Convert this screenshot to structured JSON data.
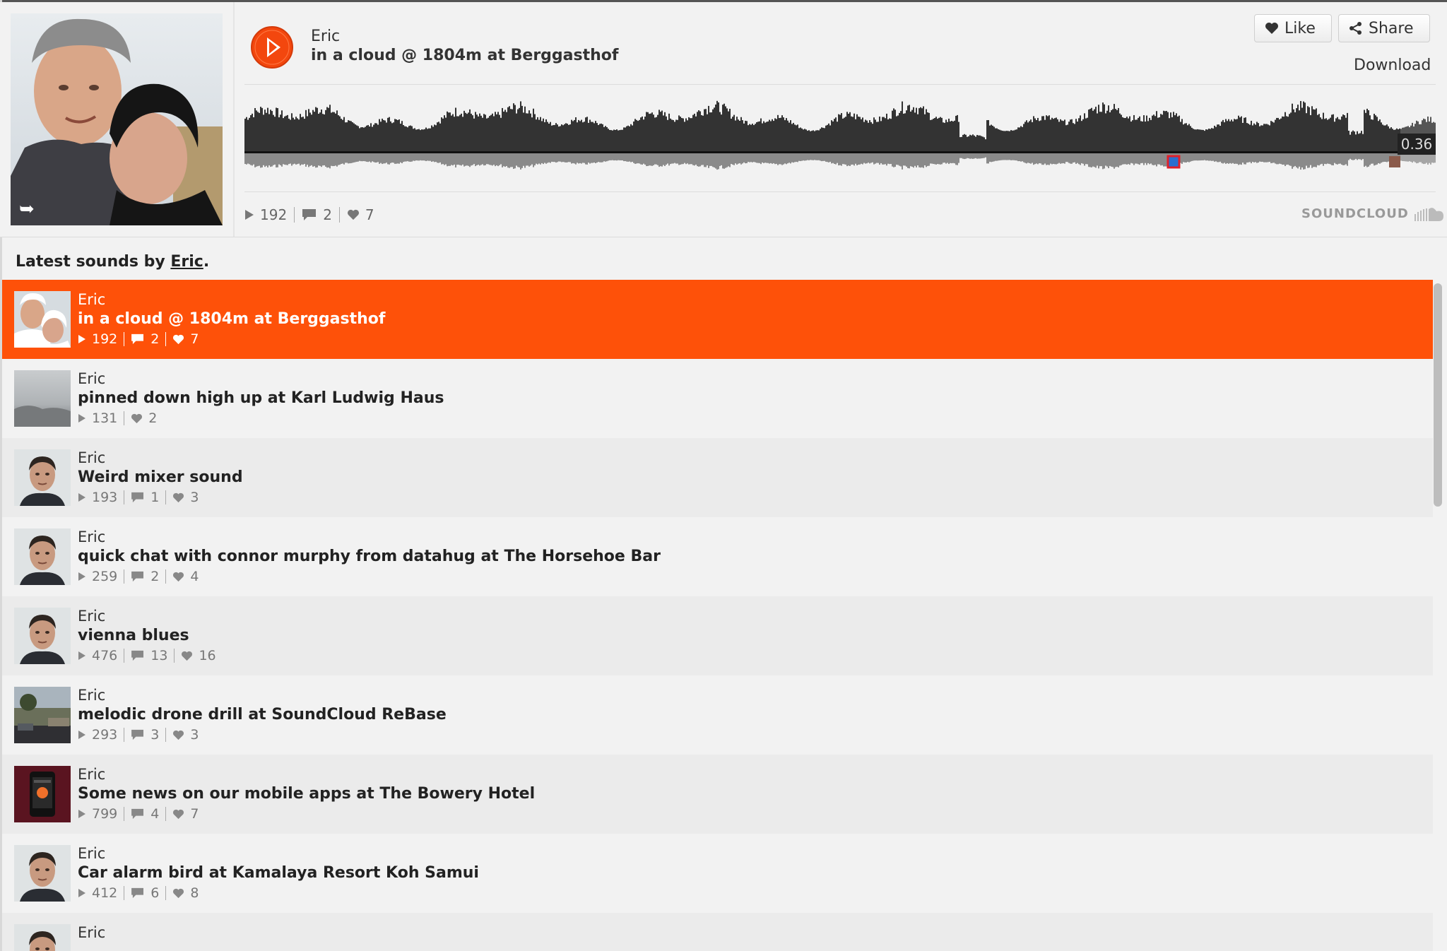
{
  "player": {
    "user": "Eric",
    "title": "in a cloud @ 1804m at Berggasthof",
    "like_label": "Like",
    "share_label": "Share",
    "download_label": "Download",
    "current_time": "0.36",
    "played_fraction": 0.97,
    "stats": {
      "plays": "192",
      "comments": "2",
      "likes": "7"
    },
    "brand": "SOUNDCLOUD",
    "accent_color": "#fe5109"
  },
  "list": {
    "heading_prefix": "Latest sounds by ",
    "heading_user": "Eric",
    "heading_suffix": ".",
    "items": [
      {
        "user": "Eric",
        "title": "in a cloud @ 1804m at Berggasthof",
        "plays": "192",
        "comments": "2",
        "likes": "7",
        "active": true,
        "thumb": "couple"
      },
      {
        "user": "Eric",
        "title": "pinned down high up at Karl Ludwig Haus",
        "plays": "131",
        "comments": null,
        "likes": "2",
        "thumb": "fog"
      },
      {
        "user": "Eric",
        "title": "Weird mixer sound",
        "plays": "193",
        "comments": "1",
        "likes": "3",
        "thumb": "face"
      },
      {
        "user": "Eric",
        "title": "quick chat with connor murphy from datahug at The Horsehoe Bar",
        "plays": "259",
        "comments": "2",
        "likes": "4",
        "thumb": "face"
      },
      {
        "user": "Eric",
        "title": "vienna blues",
        "plays": "476",
        "comments": "13",
        "likes": "16",
        "thumb": "face"
      },
      {
        "user": "Eric",
        "title": "melodic drone drill at SoundCloud ReBase",
        "plays": "293",
        "comments": "3",
        "likes": "3",
        "thumb": "street"
      },
      {
        "user": "Eric",
        "title": "Some news on our mobile apps at The Bowery Hotel",
        "plays": "799",
        "comments": "4",
        "likes": "7",
        "thumb": "phone"
      },
      {
        "user": "Eric",
        "title": "Car alarm bird at Kamalaya Resort Koh Samui",
        "plays": "412",
        "comments": "6",
        "likes": "8",
        "thumb": "face"
      },
      {
        "user": "Eric",
        "title": "",
        "plays": null,
        "comments": null,
        "likes": null,
        "thumb": "face"
      }
    ]
  }
}
